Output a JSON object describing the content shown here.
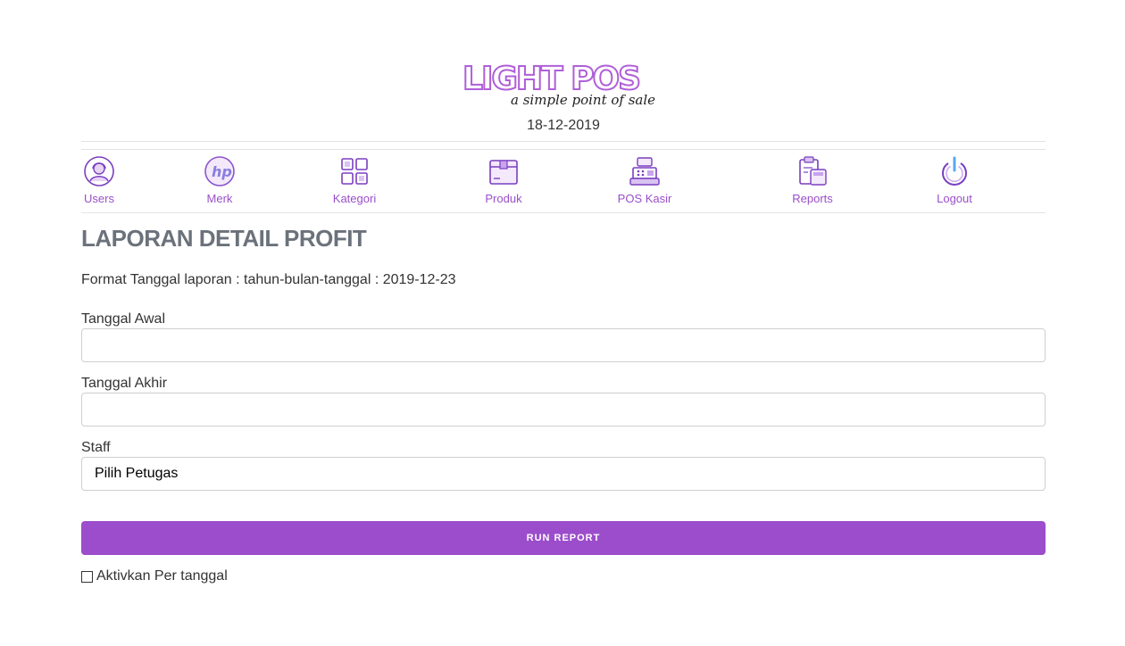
{
  "header": {
    "logo_title": "LIGHT POS",
    "logo_tagline": "a simple point of sale",
    "date": "18-12-2019"
  },
  "nav": {
    "items": [
      {
        "label": "Users",
        "icon": "users-icon"
      },
      {
        "label": "Merk",
        "icon": "hp-logo-icon"
      },
      {
        "label": "Kategori",
        "icon": "grid-icon"
      },
      {
        "label": "Produk",
        "icon": "box-icon"
      },
      {
        "label": "POS Kasir",
        "icon": "cash-register-icon"
      },
      {
        "label": "Reports",
        "icon": "report-icon"
      },
      {
        "label": "Logout",
        "icon": "power-icon"
      }
    ]
  },
  "main": {
    "title": "LAPORAN DETAIL PROFIT",
    "format_note": "Format Tanggal laporan : tahun-bulan-tanggal : 2019-12-23",
    "start_label": "Tanggal Awal",
    "start_value": "",
    "end_label": "Tanggal Akhir",
    "end_value": "",
    "staff_label": "Staff",
    "staff_selected": "Pilih Petugas",
    "run_button": "RUN REPORT",
    "checkbox_label": "Aktivkan Per tanggal",
    "checkbox_checked": false
  },
  "colors": {
    "accent": "#9b4dcb",
    "nav_text": "#9a4fc9",
    "title": "#6b727b"
  }
}
